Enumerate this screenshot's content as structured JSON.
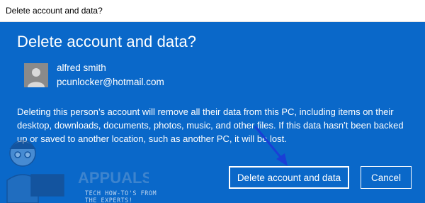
{
  "window": {
    "title": "Delete account and data?"
  },
  "dialog": {
    "heading": "Delete account and data?",
    "user": {
      "name": "alfred smith",
      "email": "pcunlocker@hotmail.com"
    },
    "message": "Deleting this person’s account will remove all their data from this PC, including items on their desktop, downloads, documents, photos, music, and other files. If this data hasn’t been backed up or saved to another location, such as another PC, it will be lost.",
    "buttons": {
      "delete_label": "Delete account and data",
      "cancel_label": "Cancel"
    }
  },
  "watermark": {
    "line1": "TECH HOW-TO'S FROM",
    "line2": "THE EXPERTS!"
  },
  "colors": {
    "dialog_bg": "#0a68c9",
    "text": "#ffffff",
    "arrow": "#1a3fd6"
  }
}
